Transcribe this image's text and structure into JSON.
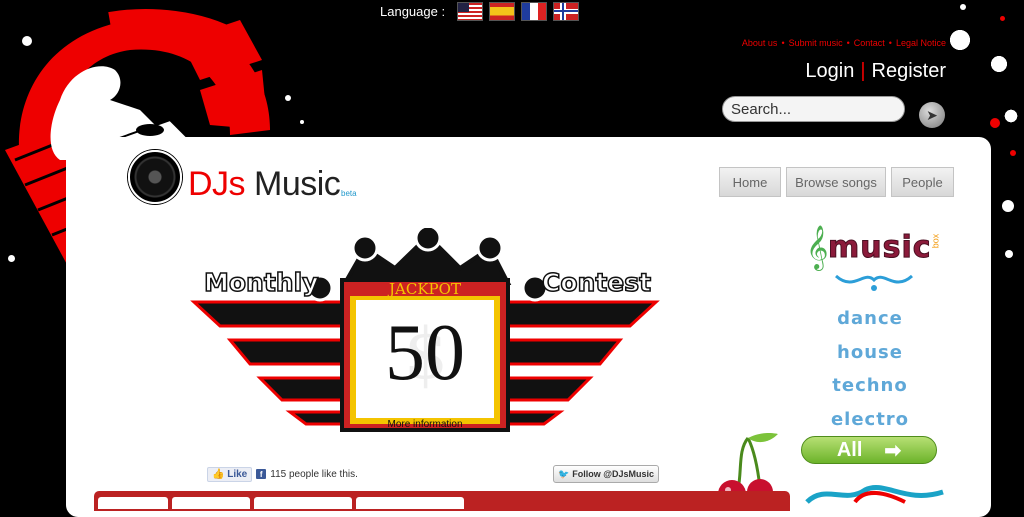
{
  "language": {
    "label": "Language :",
    "flags": [
      "us-flag-icon",
      "es-flag-icon",
      "fr-flag-icon",
      "no-flag-icon"
    ]
  },
  "top_links": [
    "About us",
    "Submit music",
    "Contact",
    "Legal Notice"
  ],
  "auth": {
    "login": "Login",
    "register": "Register"
  },
  "search": {
    "placeholder": "Search..."
  },
  "logo": {
    "prefix": "DJs",
    "name": "Music",
    "badge": "beta"
  },
  "nav": [
    "Home",
    "Browse songs",
    "People"
  ],
  "contest": {
    "left": "Monthly",
    "right": "Contest",
    "jackpot_label": "JACKPOT",
    "amount": "50",
    "more": "More information"
  },
  "sidebar": {
    "brand": "music",
    "brand_sub": "box",
    "genres": [
      "dance",
      "house",
      "techno",
      "electro"
    ],
    "all_label": "All"
  },
  "social": {
    "like_label": "Like",
    "like_count": "115 people like this.",
    "follow": "Follow @DJsMusic"
  },
  "colors": {
    "accent": "#e00000",
    "background": "#000000",
    "card": "#ffffff",
    "genre": "#5fa8d8"
  }
}
